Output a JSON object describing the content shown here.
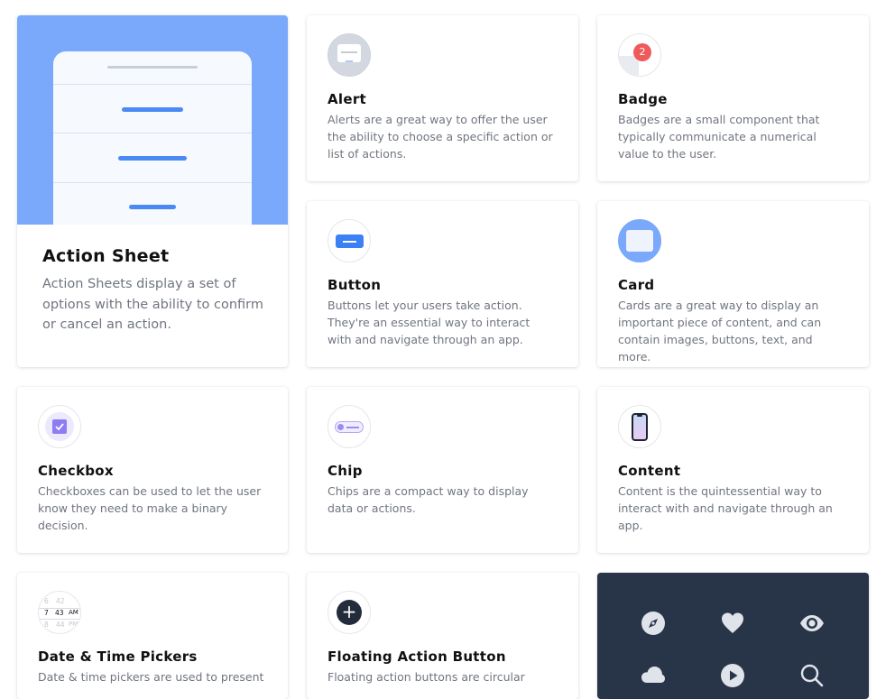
{
  "featured": {
    "title": "Action Sheet",
    "description": "Action Sheets display a set of options with the ability to confirm or cancel an action."
  },
  "components": [
    {
      "title": "Alert",
      "description": "Alerts are a great way to offer the user the ability to choose a specific action or list of actions.",
      "icon": "alert-icon"
    },
    {
      "title": "Badge",
      "description": "Badges are a small component that typically communicate a numerical value to the user.",
      "icon": "badge-icon",
      "badge_count": "2"
    },
    {
      "title": "Button",
      "description": "Buttons let your users take action. They're an essential way to interact with and navigate through an app.",
      "icon": "button-icon"
    },
    {
      "title": "Card",
      "description": "Cards are a great way to display an important piece of content, and can contain images, buttons, text, and more.",
      "icon": "card-icon"
    },
    {
      "title": "Checkbox",
      "description": "Checkboxes can be used to let the user know they need to make a binary decision.",
      "icon": "checkbox-icon"
    },
    {
      "title": "Chip",
      "description": "Chips are a compact way to display data or actions.",
      "icon": "chip-icon"
    },
    {
      "title": "Content",
      "description": "Content is the quintessential way to interact with and navigate through an app.",
      "icon": "content-icon"
    },
    {
      "title": "Date & Time Pickers",
      "description": "Date & time pickers are used to present",
      "icon": "datetime-icon",
      "picker": {
        "top": [
          "6",
          "42",
          ""
        ],
        "mid": [
          "7",
          "43",
          "AM"
        ],
        "bottom": [
          "8",
          "44",
          "PM"
        ]
      }
    },
    {
      "title": "Floating Action Button",
      "description": "Floating action buttons are circular",
      "icon": "fab-icon"
    }
  ],
  "icons_card": {
    "icons": [
      "compass-icon",
      "heart-icon",
      "eye-icon",
      "cloud-icon",
      "play-icon",
      "search-icon"
    ]
  },
  "colors": {
    "accent": "#4a8af4",
    "featured_bg": "#7aa8fb",
    "dark_card": "#283447",
    "badge": "#ef5b5b",
    "checkbox": "#8e7cf3"
  }
}
